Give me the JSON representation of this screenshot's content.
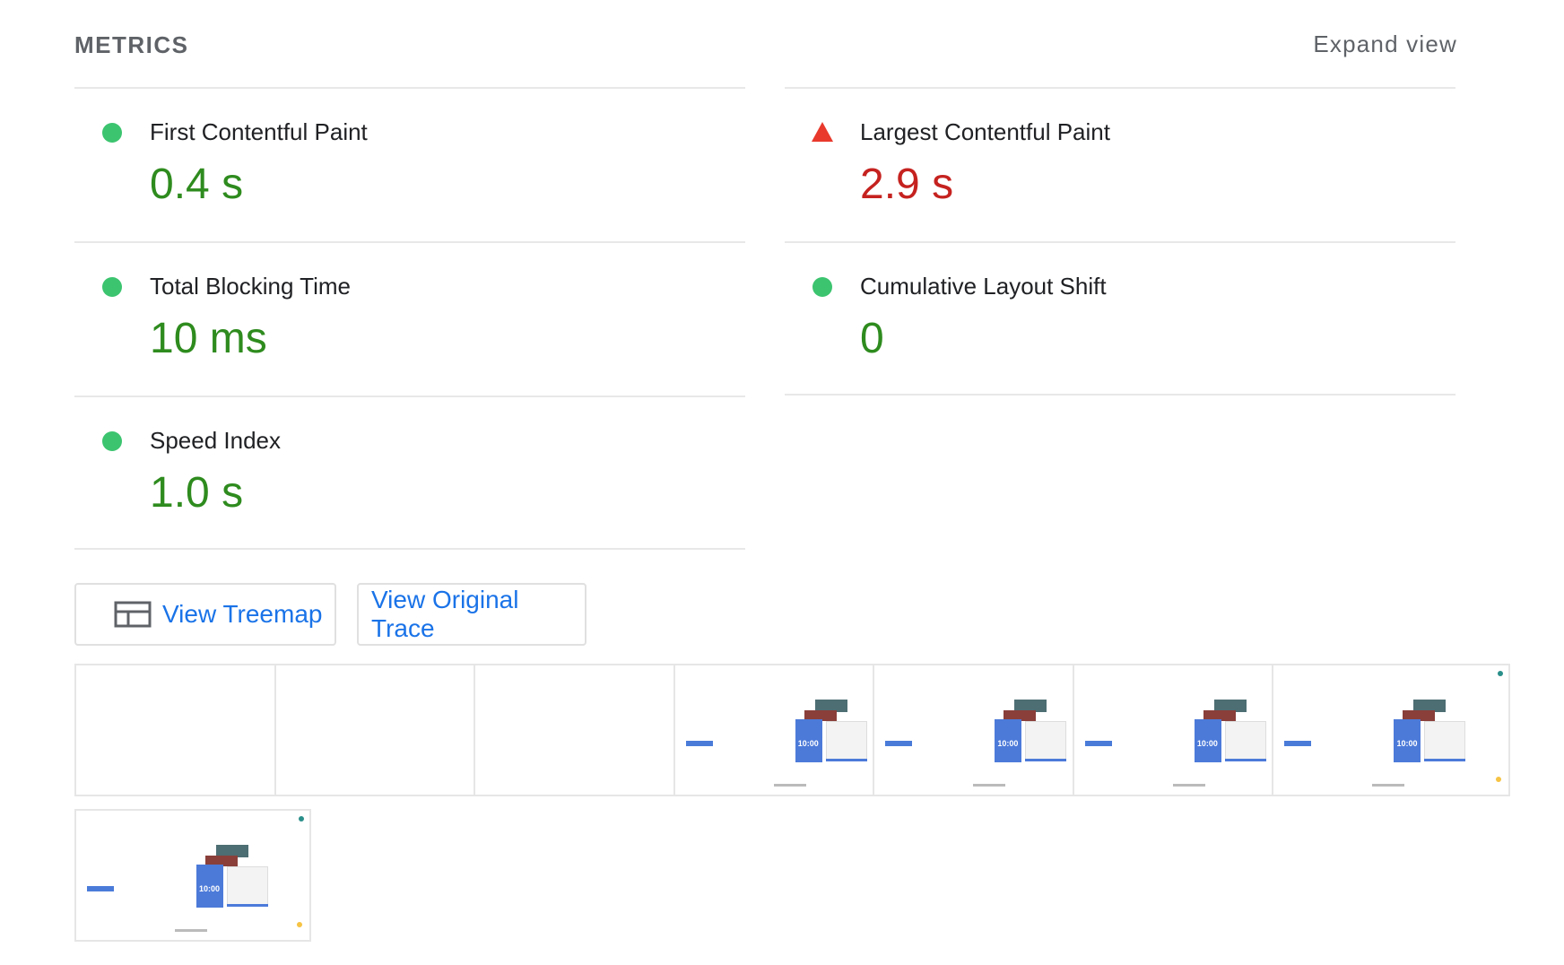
{
  "header": {
    "title": "METRICS",
    "expand_label": "Expand view"
  },
  "metrics": {
    "fcp": {
      "label": "First Contentful Paint",
      "value": "0.4 s",
      "status": "pass",
      "color": "#2e8b1e"
    },
    "lcp": {
      "label": "Largest Contentful Paint",
      "value": "2.9 s",
      "status": "fail",
      "color": "#c5221f"
    },
    "tbt": {
      "label": "Total Blocking Time",
      "value": "10 ms",
      "status": "pass",
      "color": "#2e8b1e"
    },
    "cls": {
      "label": "Cumulative Layout Shift",
      "value": "0",
      "status": "pass",
      "color": "#2e8b1e"
    },
    "si": {
      "label": "Speed Index",
      "value": "1.0 s",
      "status": "pass",
      "color": "#2e8b1e"
    }
  },
  "buttons": {
    "treemap_label": "View Treemap",
    "trace_label": "View Original Trace",
    "treemap_icon": "treemap-icon"
  },
  "filmstrip": {
    "frame_text": {
      "clock": "10:00"
    }
  }
}
